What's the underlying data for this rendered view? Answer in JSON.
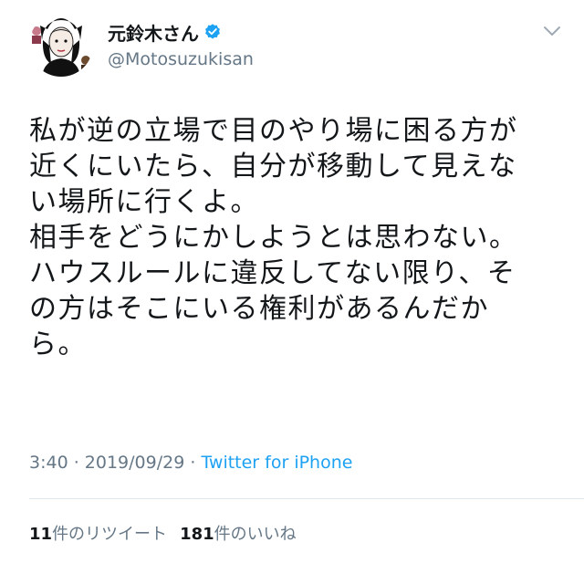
{
  "author": {
    "display_name": "元鈴木さん",
    "handle": "@Motosuzukisan",
    "verified": true
  },
  "icons": {
    "verified": "verified-badge-icon",
    "menu": "chevron-down-icon"
  },
  "tweet": {
    "lines": [
      "私が逆の立場で目のやり場に困る方が",
      "近くにいたら、自分が移動して見えな",
      "い場所に行くよ。",
      "相手をどうにかしようとは思わない。",
      "ハウスルールに違反してない限り、そ",
      "の方はそこにいる権利があるんだか",
      "ら。"
    ]
  },
  "meta": {
    "time": "3:40",
    "separator": " · ",
    "date": "2019/09/29",
    "source": "Twitter for iPhone"
  },
  "stats": {
    "retweet_count": "11",
    "retweet_label": "件のリツイート",
    "like_count": "181",
    "like_label": "件のいいね"
  },
  "colors": {
    "accent": "#1da1f2",
    "text": "#14171a",
    "secondary": "#657786",
    "divider": "#e1e8ed"
  }
}
